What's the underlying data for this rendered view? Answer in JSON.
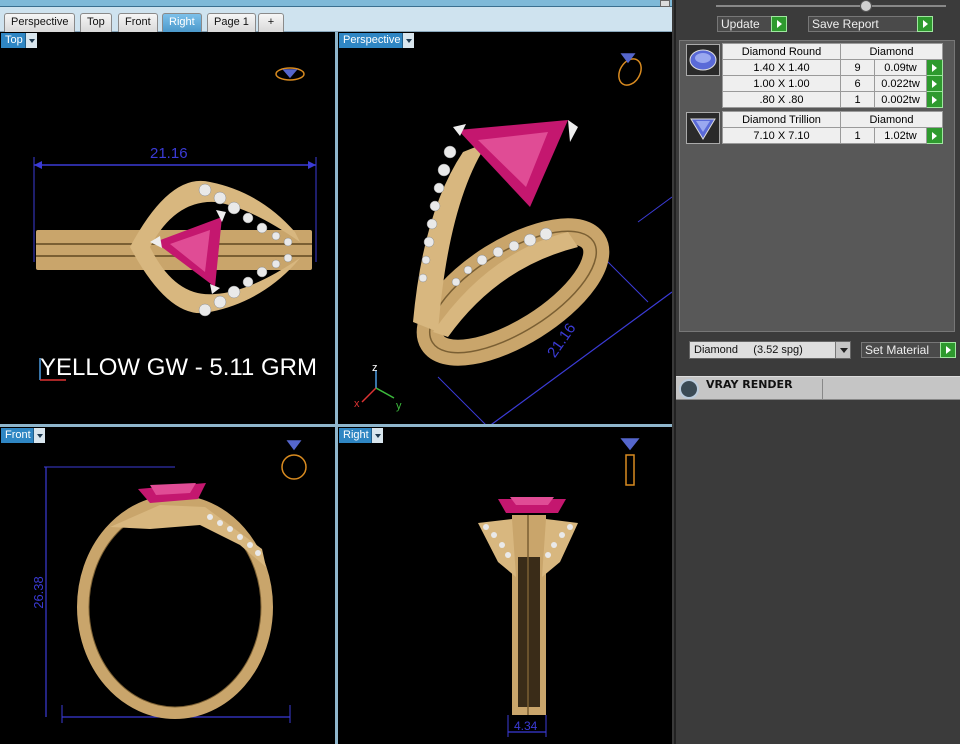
{
  "tabs": [
    {
      "label": "Perspective",
      "active": false
    },
    {
      "label": "Top",
      "active": false
    },
    {
      "label": "Front",
      "active": false
    },
    {
      "label": "Right",
      "active": true
    },
    {
      "label": "Page 1",
      "active": false
    },
    {
      "label": "+",
      "active": false
    }
  ],
  "viewports": {
    "top": {
      "label": "Top",
      "dimension": "21.16"
    },
    "perspective": {
      "label": "Perspective",
      "dimension": "21.16"
    },
    "front": {
      "label": "Front",
      "dimension": "26.38"
    },
    "right": {
      "label": "Right",
      "dimension": "4.34"
    }
  },
  "overlay_text": "YELLOW GW - 5.11 GRM",
  "axes": {
    "x": "x",
    "y": "y",
    "z": "z"
  },
  "panel": {
    "update_label": "Update",
    "save_report_label": "Save Report",
    "stone_groups": [
      {
        "icon": "round-diamond-icon",
        "header": [
          "Diamond Round",
          "Diamond"
        ],
        "rows": [
          {
            "size": "1.40 X 1.40",
            "count": "9",
            "weight": "0.09tw"
          },
          {
            "size": "1.00 X 1.00",
            "count": "6",
            "weight": "0.022tw"
          },
          {
            "size": ".80 X .80",
            "count": "1",
            "weight": "0.002tw"
          }
        ]
      },
      {
        "icon": "trillion-diamond-icon",
        "header": [
          "Diamond Trillion",
          "Diamond"
        ],
        "rows": [
          {
            "size": "7.10 X 7.10",
            "count": "1",
            "weight": "1.02tw"
          }
        ]
      }
    ],
    "material_select": "Diamond     (3.52 spg)",
    "set_material_label": "Set Material",
    "vray_label": "VRAY RENDER"
  },
  "colors": {
    "gold": "#d2b07a",
    "ruby": "#c4176f",
    "dim_line": "#3b3bd6",
    "viewport_bg": "#000000",
    "tab_active": "#4b99cb"
  }
}
